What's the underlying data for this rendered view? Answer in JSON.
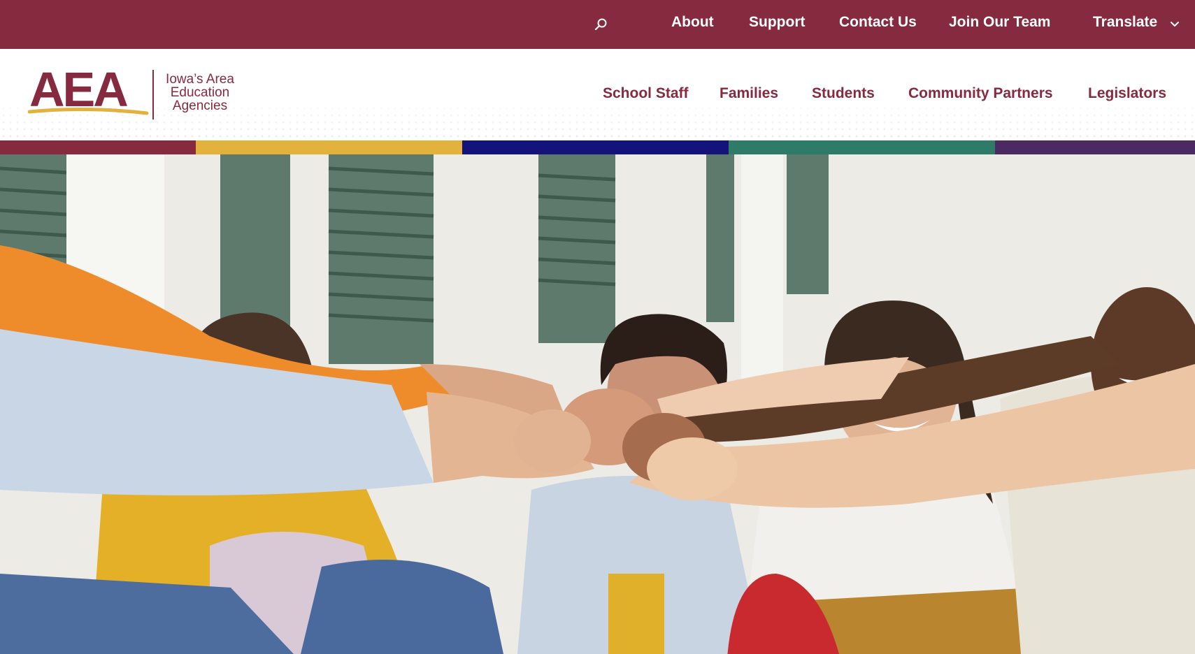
{
  "utility_nav": {
    "search_icon": "search-icon",
    "links": [
      "About",
      "Support",
      "Contact Us",
      "Join Our Team"
    ],
    "translate": {
      "label": "Translate",
      "icon": "chevron-down-icon"
    }
  },
  "logo": {
    "wordmark": "AEA",
    "tagline": [
      "Iowa’s Area",
      "Education",
      "Agencies"
    ]
  },
  "main_nav": {
    "items": [
      "School Staff",
      "Families",
      "Students",
      "Community Partners",
      "Legislators"
    ]
  },
  "colors": {
    "brand_maroon": "#862a3f",
    "stripe": [
      "#862a3f",
      "#e3b23c",
      "#14137a",
      "#2e7c67",
      "#4b2a63"
    ]
  },
  "hero": {
    "image": "photo of five smiling young people joining fists in the center"
  }
}
